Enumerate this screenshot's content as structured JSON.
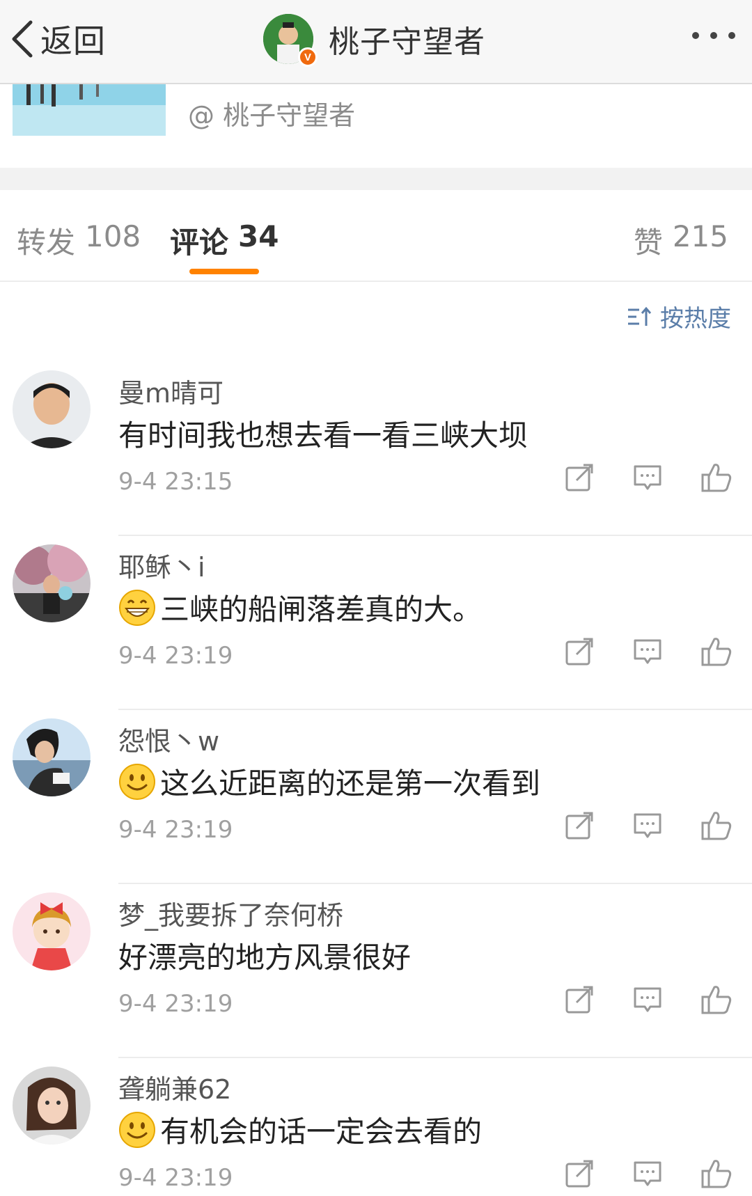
{
  "nav": {
    "back_label": "返回",
    "title": "桃子守望者",
    "verified_badge": "V",
    "more_icon": "more-dots-icon"
  },
  "preview": {
    "author": "@ 桃子守望者"
  },
  "tabs": [
    {
      "label": "转发",
      "count": "108"
    },
    {
      "label": "评论",
      "count": "34"
    },
    {
      "label": "赞",
      "count": "215"
    }
  ],
  "sort": {
    "label": "按热度",
    "icon": "sort-icon"
  },
  "colors": {
    "accent": "#ff8200",
    "link": "#5b7ea9",
    "verified": "#f06a0e"
  },
  "comments": [
    {
      "user": "曼m晴可",
      "emoji": "",
      "text": "有时间我也想去看一看三峡大坝",
      "time": "9-4 23:15"
    },
    {
      "user": "耶稣丶i",
      "emoji": "grin-emoji",
      "text": "三峡的船闸落差真的大。",
      "time": "9-4 23:19"
    },
    {
      "user": "怨恨丶w",
      "emoji": "smile-emoji",
      "text": "这么近距离的还是第一次看到",
      "time": "9-4 23:19"
    },
    {
      "user": "梦_我要拆了奈何桥",
      "emoji": "",
      "text": "好漂亮的地方风景很好",
      "time": "9-4 23:19"
    },
    {
      "user": "聋躺兼62",
      "emoji": "smile-emoji",
      "text": "有机会的话一定会去看的",
      "time": "9-4 23:19"
    }
  ]
}
